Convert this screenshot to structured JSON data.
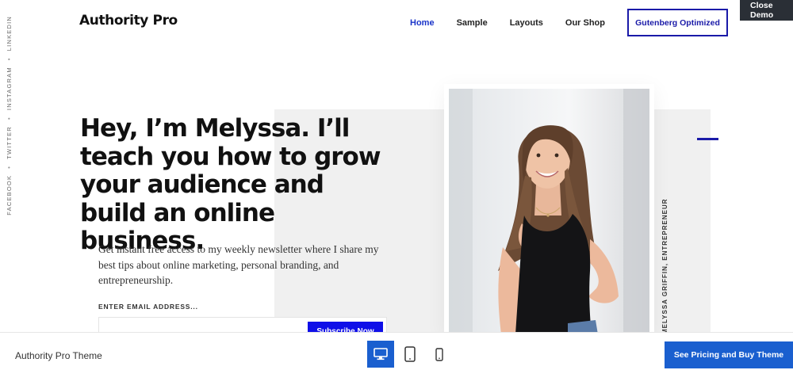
{
  "social": {
    "links": [
      "Facebook",
      "Twitter",
      "Instagram",
      "LinkedIn"
    ],
    "separator": "•"
  },
  "header": {
    "logo": "Authority Pro",
    "nav": [
      "Home",
      "Sample",
      "Layouts",
      "Our Shop"
    ],
    "active_nav": "Home",
    "cta": "Gutenberg Optimized",
    "close_demo": "Close Demo"
  },
  "hero": {
    "headline": "Hey, I’m Melyssa. I’ll teach you how to grow your audience and build an online business.",
    "intro": "Get instant free access to my weekly newsletter where I share my best tips about online marketing, personal branding, and entrepreneurship.",
    "email_label": "ENTER EMAIL ADDRESS...",
    "email_value": "",
    "subscribe_button": "Subscribe Now",
    "photo_caption": "MELYSSA GRIFFIN, ENTREPRENEUR"
  },
  "bottom_bar": {
    "theme_name": "Authority Pro Theme",
    "devices": [
      "desktop-icon",
      "tablet-icon",
      "mobile-icon"
    ],
    "active_device": "desktop",
    "buy_button": "See Pricing and Buy Theme"
  },
  "colors": {
    "accent_blue": "#1a1aa8",
    "subscribe_blue": "#0f0fe8",
    "bar_blue": "#1a5fcf",
    "close_demo_bg": "#2a2f36"
  }
}
